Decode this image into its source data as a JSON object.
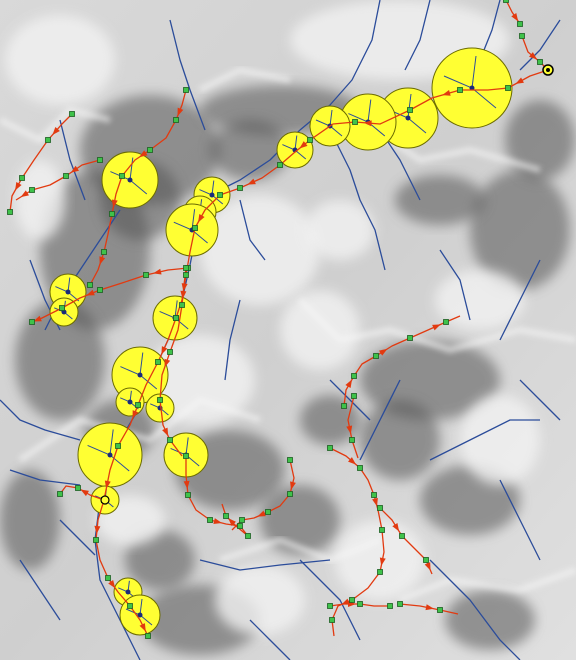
{
  "map": {
    "kind": "shaded-relief terrain with stream network and traced paths",
    "colors": {
      "terrain_light": "#f2f2f2",
      "terrain_mid": "#a6a6a6",
      "terrain_dark": "#555555",
      "terrain_shadow": "#3a3a3a",
      "stream": "#2b4c9a",
      "path": "#e23a10",
      "node_fill": "#3fc24a",
      "node_stroke": "#1d5e22",
      "buffer_fill": "#ffff33",
      "buffer_stroke": "#6b6b00",
      "center_fill": "#1a2a7a"
    },
    "icons": {
      "node": "green-square-vertex",
      "arrow": "red-triangle-direction-marker",
      "buffer": "yellow-circle-buffer",
      "origin": "black-circle-outlet-marker"
    }
  }
}
